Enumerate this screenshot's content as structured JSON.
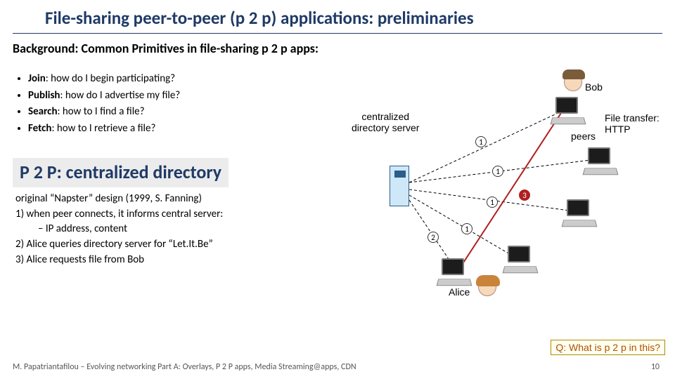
{
  "title": "File-sharing peer-to-peer (p 2 p) applications: preliminaries",
  "subtitle": "Background: Common Primitives in file-sharing  p 2 p apps:",
  "bullets": [
    {
      "term": "Join",
      "rest": ": how do I begin participating?"
    },
    {
      "term": "Publish",
      "rest": ": how do I advertise my file?"
    },
    {
      "term": "Search",
      "rest": ": how to I find a file?"
    },
    {
      "term": "Fetch",
      "rest": ": how to I retrieve a file?"
    }
  ],
  "section": "P 2 P: centralized directory",
  "body": {
    "line1": "original “Napster” design (1999,  S.  Fanning)",
    "step1": "1) when peer connects, it informs central server:",
    "substep": "–   IP address, content",
    "step2": "2) Alice queries directory server for “Let.It.Be”",
    "step3": "3) Alice requests file from Bob"
  },
  "diagram": {
    "server_label": "centralized\ndirectory server",
    "bob": "Bob",
    "alice": "Alice",
    "peers": "peers",
    "transfer": "File transfer:\nHTTP",
    "n1": "1",
    "n2": "2",
    "n3": "3"
  },
  "question": "Q: What is p 2 p in this?",
  "footer": "M. Papatriantafilou –   Evolving networking Part A: Overlays, P 2 P apps, Media Streaming@apps, CDN",
  "page": "10"
}
